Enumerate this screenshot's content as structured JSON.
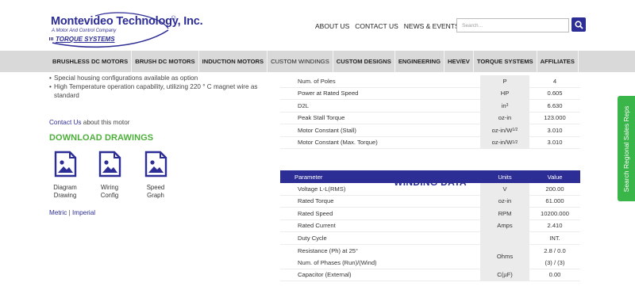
{
  "header": {
    "logo": {
      "company_name": "Montevideo Technology, Inc.",
      "mark": "☺",
      "tagline": "A Motor And Control Company",
      "sub_brand": "TORQUE SYSTEMS"
    },
    "top_links": [
      "ABOUT US",
      "CONTACT US",
      "NEWS & EVENTS"
    ],
    "search": {
      "placeholder": "Search..."
    }
  },
  "main_nav": [
    "BRUSHLESS DC MOTORS",
    "BRUSH DC MOTORS",
    "INDUCTION MOTORS",
    "CUSTOM WINDINGS",
    "CUSTOM DESIGNS",
    "ENGINEERING",
    "HEV/EV",
    "TORQUE SYSTEMS",
    "AFFILIATES"
  ],
  "left": {
    "bullets": [
      "Special housing configurations available as option",
      "High Temperature operation capability, utilizing 220 ° C magnet wire as standard"
    ],
    "contact_link": "Contact Us",
    "contact_rest": " about this motor",
    "downloads_title": "DOWNLOAD DRAWINGS",
    "downloads": [
      {
        "line1": "Diagram",
        "line2": "Drawing",
        "icon": "image-file-icon"
      },
      {
        "line1": "Wiring",
        "line2": "Config",
        "icon": "image-file-icon"
      },
      {
        "line1": "Speed",
        "line2": "Graph",
        "icon": "image-file-icon"
      }
    ],
    "units": {
      "metric": "Metric",
      "separator": "|",
      "imperial": "Imperial"
    }
  },
  "specs_table": {
    "rows": [
      {
        "name": "Num. of Poles",
        "unit": "P",
        "value": "4"
      },
      {
        "name": "Power at Rated Speed",
        "unit": "HP",
        "value": "0.605"
      },
      {
        "name": "D2L",
        "unit": "in",
        "unit_sup": "3",
        "value": "6.630"
      },
      {
        "name": "Peak Stall Torque",
        "unit": "oz-in",
        "value": "123.000"
      },
      {
        "name": "Motor Constant (Stall)",
        "unit": "oz-in/W",
        "unit_sup": "1/2",
        "value": "3.010"
      },
      {
        "name": "Motor Constant (Max. Torque)",
        "unit": "oz-in/W",
        "unit_sup": "1/2",
        "value": "3.010"
      }
    ]
  },
  "winding": {
    "title": "WINDING DATA",
    "header": {
      "parameter": "Parameter",
      "units": "Units",
      "value": "Value"
    },
    "rows": [
      {
        "name": "Voltage L-L(RMS)",
        "unit": "V",
        "value": "200.00"
      },
      {
        "name": "Rated Torque",
        "unit": "oz-in",
        "value": "61.000"
      },
      {
        "name": "Rated Speed",
        "unit": "RPM",
        "value": "10200.000"
      },
      {
        "name": "Rated Current",
        "unit": "Amps",
        "value": "2.410"
      },
      {
        "name": "Duty Cycle",
        "unit": "",
        "value": "INT."
      },
      {
        "name": "Resistance (Ph) at 25°",
        "unit": "Ohms",
        "value": "2.8 / 0.0"
      },
      {
        "name": "Num. of Phases (Run)/(Wind)",
        "unit": "",
        "value": "(3) / (3)"
      },
      {
        "name": "Capacitor (External)",
        "unit": "C(µF)",
        "value": "0.00"
      }
    ]
  },
  "side_tab": {
    "label": "Search Regional Sales Reps"
  },
  "colors": {
    "brand_blue": "#2d2d96",
    "accent_green": "#4caf3a",
    "side_tab_green": "#39b54a",
    "nav_gray": "#d9d9d9"
  }
}
